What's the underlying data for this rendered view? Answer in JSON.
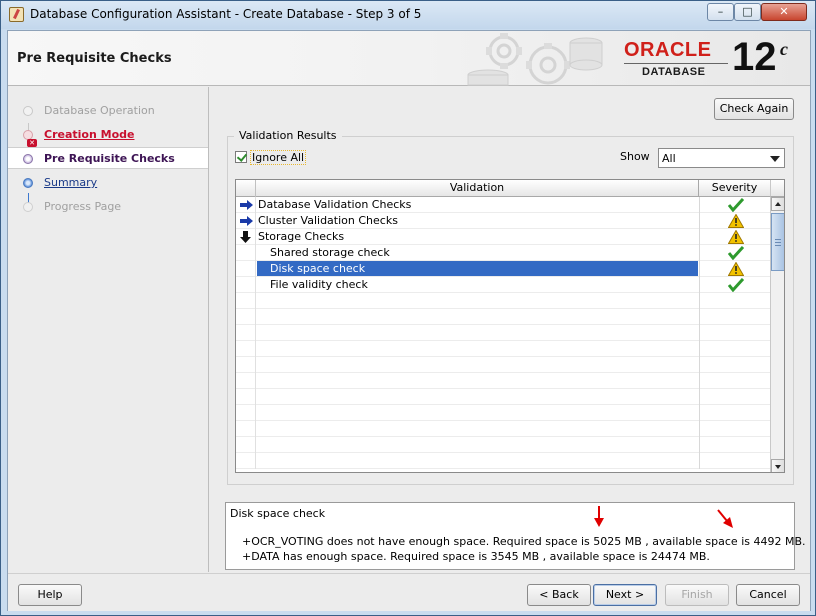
{
  "window": {
    "title": "Database Configuration Assistant - Create Database - Step 3 of 5",
    "controls": {
      "minimize": "–",
      "maximize": "□",
      "close": "✕"
    }
  },
  "header": {
    "page_title": "Pre Requisite Checks",
    "brand": "ORACLE",
    "product": "DATABASE",
    "version": "12",
    "version_sup": "c"
  },
  "nav": {
    "steps": [
      {
        "label": "Database Operation",
        "state": "done"
      },
      {
        "label": "Creation Mode",
        "state": "error"
      },
      {
        "label": "Pre Requisite Checks",
        "state": "current"
      },
      {
        "label": "Summary",
        "state": "link"
      },
      {
        "label": "Progress Page",
        "state": "pending"
      }
    ]
  },
  "toolbar": {
    "check_again": "Check Again",
    "check_again_mnemonic": "h"
  },
  "validation": {
    "group_title": "Validation Results",
    "ignore_all_label": "Ignore All",
    "ignore_all_checked": true,
    "show_label": "Show",
    "show_value": "All",
    "columns": {
      "validation": "Validation",
      "severity": "Severity"
    },
    "rows": [
      {
        "name": "Database Validation Checks",
        "level": 0,
        "expand": "collapsed",
        "severity": "ok",
        "selected": false
      },
      {
        "name": "Cluster Validation Checks",
        "level": 0,
        "expand": "collapsed",
        "severity": "warning",
        "selected": false
      },
      {
        "name": "Storage Checks",
        "level": 0,
        "expand": "expanded",
        "severity": "warning",
        "selected": false
      },
      {
        "name": "Shared storage check",
        "level": 1,
        "expand": "none",
        "severity": "ok",
        "selected": false
      },
      {
        "name": "Disk space check",
        "level": 1,
        "expand": "none",
        "severity": "warning",
        "selected": true
      },
      {
        "name": "File validity check",
        "level": 1,
        "expand": "none",
        "severity": "ok",
        "selected": false
      }
    ]
  },
  "details": {
    "title": "Disk space check",
    "lines": [
      "+OCR_VOTING does not have enough space. Required space is 5025 MB , available space is 4492 MB.",
      "+DATA has enough space. Required space is 3545 MB , available space is 24474 MB."
    ]
  },
  "footer": {
    "help": "Help",
    "back": "< Back",
    "next": "Next >",
    "finish": "Finish",
    "cancel": "Cancel"
  },
  "colors": {
    "oracle_red": "#d0201a",
    "selection": "#336ac4",
    "ok_green": "#2e9a2e",
    "warning_yellow": "#f2c200",
    "annotation_red": "#e00000"
  }
}
